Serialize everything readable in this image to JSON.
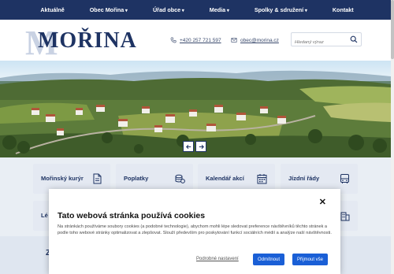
{
  "nav": {
    "items": [
      {
        "label": "Aktuálně",
        "dropdown": false
      },
      {
        "label": "Obec Mořina",
        "dropdown": true
      },
      {
        "label": "Úřad obce",
        "dropdown": true
      },
      {
        "label": "Media",
        "dropdown": true
      },
      {
        "label": "Spolky & sdružení",
        "dropdown": true
      },
      {
        "label": "Kontakt",
        "dropdown": false
      }
    ]
  },
  "header": {
    "logo_initial": "M",
    "logo_text": "MOŘINA",
    "phone": "+420 257 721 597",
    "email": "obec@morina.cz",
    "search_placeholder": "Hledaný výraz"
  },
  "hero": {
    "prev_icon": "arrow-left-icon",
    "next_icon": "arrow-right-icon"
  },
  "tiles": [
    {
      "label": "Mořinský kurýr",
      "icon": "document-icon"
    },
    {
      "label": "Poplatky",
      "icon": "coins-icon"
    },
    {
      "label": "Kalendář akcí",
      "icon": "calendar-icon"
    },
    {
      "label": "Jízdní řády",
      "icon": "bus-icon"
    },
    {
      "label": "Lé",
      "icon": ""
    },
    {
      "label": "",
      "icon": "building-icon"
    }
  ],
  "bottom_band": {
    "partial_text": "Z"
  },
  "cookie": {
    "title": "Tato webová stránka používá cookies",
    "text": "Na stránkách používáme soubory cookies (a podobné technologie), abychom mohli lépe sledovat preference návštěvníků těchto stránek a podle toho webové stránky optimalizovat a zlepšovat. Slouží především pro poskytování funkcí sociálních médií a analýze naší návštěvnosti.",
    "settings_link": "Podrobné nastavení",
    "reject_label": "Odmítnout",
    "accept_label": "Přijmout vše",
    "accent_color": "#1a5fd6"
  },
  "colors": {
    "nav_bg": "#1e3363",
    "tile_bg": "#e4e9f2"
  }
}
